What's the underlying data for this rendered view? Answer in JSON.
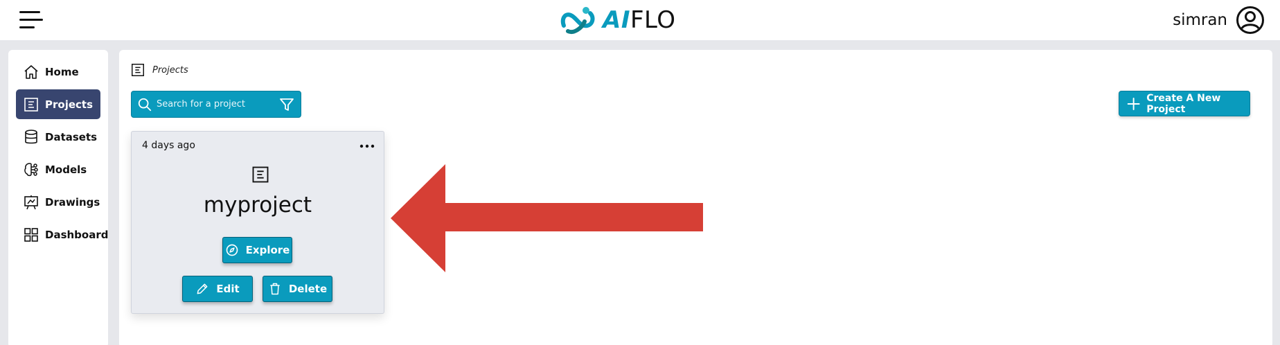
{
  "header": {
    "logo_ai": "AI",
    "logo_flo": "FLO",
    "username": "simran"
  },
  "sidebar": {
    "items": [
      {
        "label": "Home",
        "icon": "home-icon",
        "active": false
      },
      {
        "label": "Projects",
        "icon": "projects-icon",
        "active": true
      },
      {
        "label": "Datasets",
        "icon": "database-icon",
        "active": false
      },
      {
        "label": "Models",
        "icon": "models-icon",
        "active": false
      },
      {
        "label": "Drawings",
        "icon": "drawings-icon",
        "active": false
      },
      {
        "label": "Dashboard",
        "icon": "dashboard-icon",
        "active": false
      }
    ]
  },
  "breadcrumb": {
    "label": "Projects"
  },
  "search": {
    "placeholder": "Search for a project"
  },
  "toolbar": {
    "create_label": "Create A New Project"
  },
  "project_card": {
    "date": "4 days ago",
    "title": "myproject",
    "explore_label": "Explore",
    "edit_label": "Edit",
    "delete_label": "Delete"
  },
  "colors": {
    "accent": "#0a9bbd",
    "sidebar_active": "#38456f",
    "annotation_arrow": "#d63f35"
  }
}
